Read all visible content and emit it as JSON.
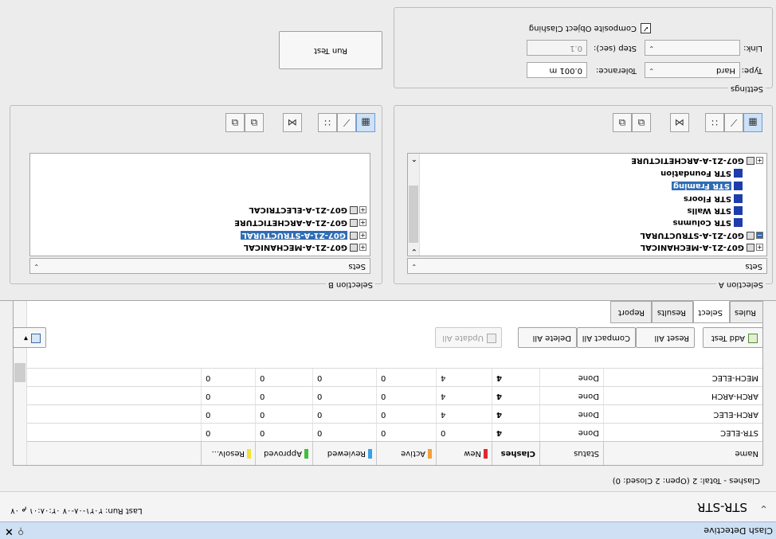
{
  "window": {
    "title": "Clash Detective",
    "close_glyph": "×",
    "pin_glyph": "⚲"
  },
  "test": {
    "name": "STR-STR",
    "last_run": "Last Run: ‏ ۰۷ م ۰۲:۰۸:۰۱ ۰۷-۰۸-۲۰۲۱",
    "summary": "Clashes - Total:  2  (Open:  2  Closed:  0)"
  },
  "grid": {
    "columns": [
      {
        "label": "Name"
      },
      {
        "label": "Status"
      },
      {
        "label": "Clashes"
      },
      {
        "label": "New",
        "color": "#e0272f"
      },
      {
        "label": "Active",
        "color": "#f29f3a"
      },
      {
        "label": "Reviewed",
        "color": "#3aa0e6"
      },
      {
        "label": "Approved",
        "color": "#3cc03c"
      },
      {
        "label": "Resolv...",
        "color": "#f3e233"
      }
    ],
    "rows": [
      {
        "name": "STR-ELEC",
        "status": "Done",
        "clashes": "4",
        "new": "0",
        "active": "0",
        "reviewed": "0",
        "approved": "0",
        "resolved": "0"
      },
      {
        "name": "ARCH-ELEC",
        "status": "Done",
        "clashes": "4",
        "new": "4",
        "active": "0",
        "reviewed": "0",
        "approved": "0",
        "resolved": "0"
      },
      {
        "name": "ARCH-ARCH",
        "status": "Done",
        "clashes": "4",
        "new": "4",
        "active": "0",
        "reviewed": "0",
        "approved": "0",
        "resolved": "0"
      },
      {
        "name": "MECH-ELEC",
        "status": "Done",
        "clashes": "4",
        "new": "4",
        "active": "0",
        "reviewed": "0",
        "approved": "0",
        "resolved": "0"
      }
    ]
  },
  "toolbar": {
    "add_test": "Add Test",
    "reset_all": "Reset All",
    "compact_all": "Compact All",
    "delete_all": "Delete All",
    "update_all": "Update All",
    "import_export_arrow": "▾"
  },
  "tabs": [
    "Rules",
    "Select",
    "Results",
    "Report"
  ],
  "selection_a": {
    "label": "Selection A",
    "dropdown": "Sets",
    "tree": [
      {
        "text": "G07-Z1-A-MECHANICAL",
        "expander": "+",
        "level": 0
      },
      {
        "text": "G07-Z1-A-STRUCTURAL",
        "expander": "−",
        "level": 0
      },
      {
        "text": "STR Columns",
        "level": 1
      },
      {
        "text": "STR Walls",
        "level": 1
      },
      {
        "text": "STR Floors",
        "level": 1
      },
      {
        "text": "STR Framing",
        "level": 1,
        "selected": true
      },
      {
        "text": "STR Foundation",
        "level": 1
      },
      {
        "text": "G07-Z1-A-ARCHETICTURE",
        "expander": "+",
        "level": 0
      }
    ]
  },
  "selection_b": {
    "label": "Selection B",
    "dropdown": "Sets",
    "tree": [
      {
        "text": "G07-Z1-A-MECHANICAL",
        "expander": "+",
        "level": 0
      },
      {
        "text": "G07-Z1-A-STRUCTURAL",
        "expander": "+",
        "level": 0,
        "selected": true
      },
      {
        "text": "G07-Z1-A-ARCHETICTURE",
        "expander": "+",
        "level": 0
      },
      {
        "text": "G07-Z1-A-ELECTRICAL",
        "expander": "+",
        "level": 0
      }
    ]
  },
  "settings": {
    "label": "Settings",
    "type_label": "Type:",
    "type_value": "Hard",
    "tolerance_label": "Tolerance:",
    "tolerance_value": "0.001 m",
    "link_label": "Link:",
    "link_value": "",
    "step_label": "Step (sec):",
    "step_value": "0.1",
    "composite_label": "Composite Object Clashing",
    "composite_checked": "✓",
    "run_test": "Run Test"
  },
  "icons": {
    "dropdown_arrow": "⌄",
    "scroll_up": "⌃",
    "scroll_down": "⌄",
    "chevron": "⌄"
  }
}
